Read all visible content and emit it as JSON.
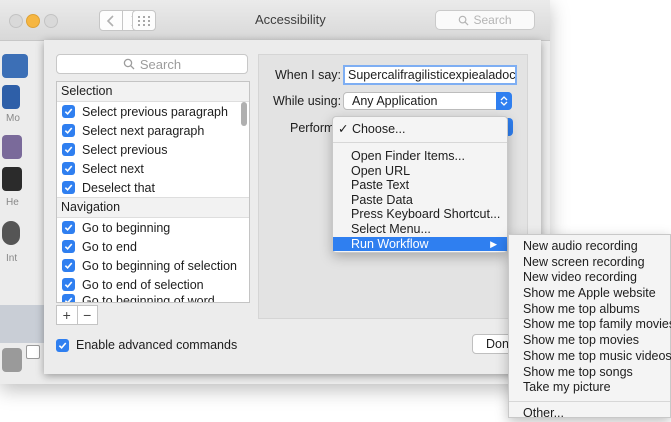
{
  "window": {
    "title": "Accessibility",
    "search_placeholder": "Search"
  },
  "sidebar_peek": {
    "labels": [
      "Mo",
      "He",
      "Int"
    ]
  },
  "sheet": {
    "search_placeholder": "Search",
    "sections": [
      {
        "title": "Selection",
        "items": [
          "Select previous paragraph",
          "Select next paragraph",
          "Select previous",
          "Select next",
          "Deselect that"
        ]
      },
      {
        "title": "Navigation",
        "items": [
          "Go to beginning",
          "Go to end",
          "Go to beginning of selection",
          "Go to end of selection",
          "Go to beginning of word"
        ]
      }
    ],
    "add_label": "+",
    "remove_label": "−",
    "enable_advanced_label": "Enable advanced commands",
    "when_i_say_label": "When I say:",
    "when_i_say_value": "Supercalifragilisticexpiealadocious",
    "while_using_label": "While using:",
    "while_using_value": "Any Application",
    "perform_label": "Perform",
    "done_label": "Done"
  },
  "perform_menu": {
    "checked_item": "Choose...",
    "items": [
      "Open Finder Items...",
      "Open URL",
      "Paste Text",
      "Paste Data",
      "Press Keyboard Shortcut...",
      "Select Menu...",
      "Run Workflow"
    ],
    "highlighted": "Run Workflow"
  },
  "workflow_submenu": {
    "items": [
      "New audio recording",
      "New screen recording",
      "New video recording",
      "Show me Apple website",
      "Show me top albums",
      "Show me top family movies",
      "Show me top movies",
      "Show me top music videos",
      "Show me top songs",
      "Take my picture"
    ],
    "other": "Other..."
  },
  "colors": {
    "accent": "#2f7ff0",
    "window_bg": "#ececec",
    "minimize_light": "#f6b641"
  }
}
